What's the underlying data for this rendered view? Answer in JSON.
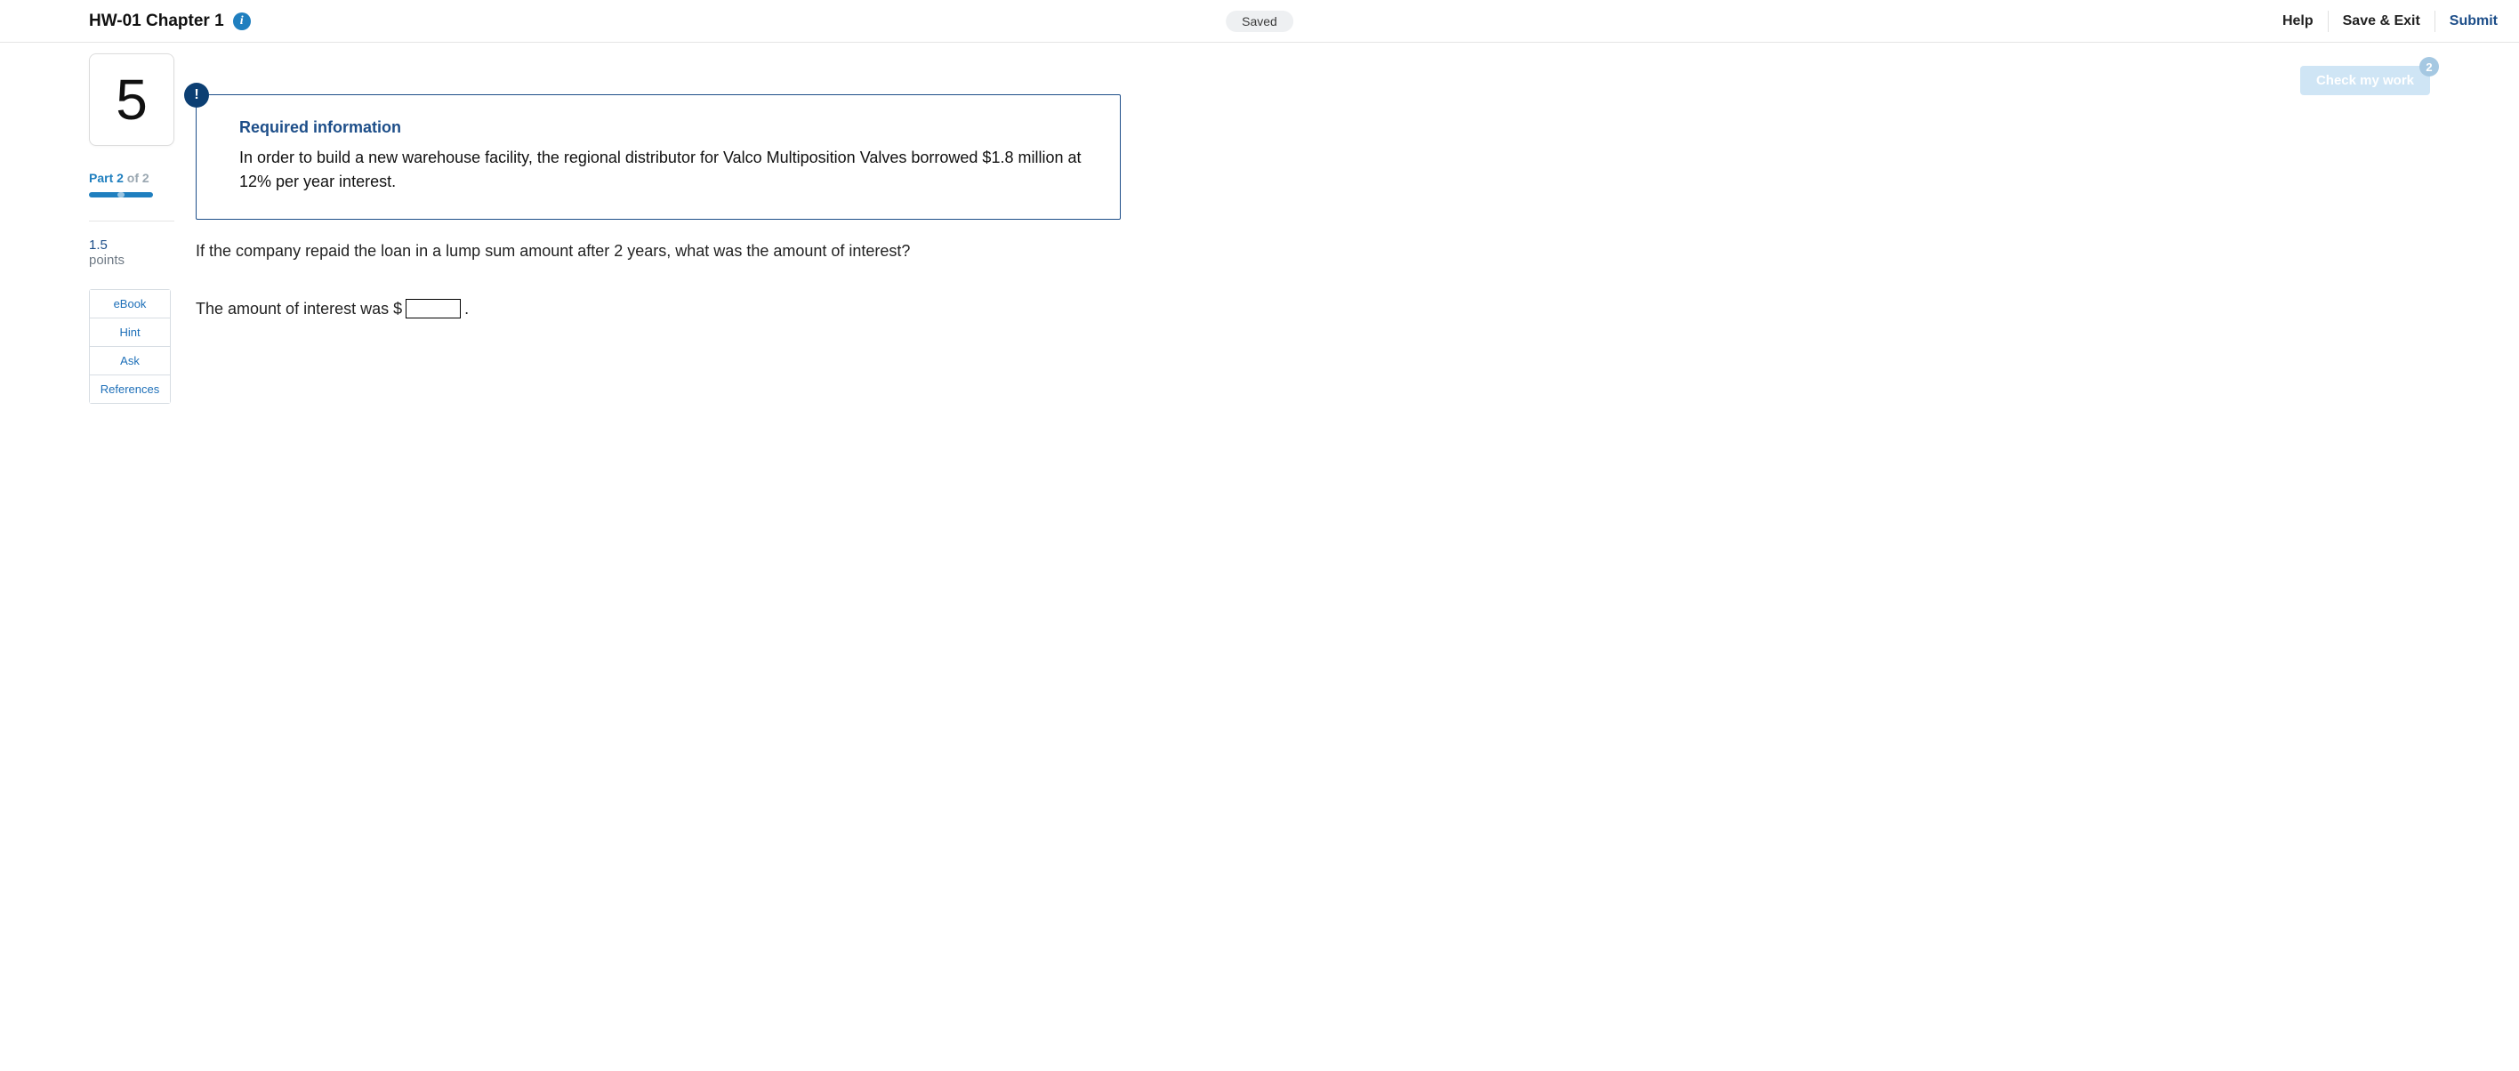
{
  "header": {
    "title": "HW-01 Chapter 1",
    "info_icon": "i",
    "saved_label": "Saved",
    "actions": {
      "help": "Help",
      "save_exit": "Save & Exit",
      "submit": "Submit"
    }
  },
  "check_work": {
    "label": "Check my work",
    "badge": "2"
  },
  "question": {
    "number": "5",
    "part_current": "Part 2",
    "part_of": " of 2",
    "points_value": "1.5",
    "points_label": "points"
  },
  "side_buttons": {
    "ebook": "eBook",
    "hint": "Hint",
    "ask": "Ask",
    "references": "References"
  },
  "required_info": {
    "badge": "!",
    "title": "Required information",
    "body": "In order to build a new warehouse facility, the regional distributor for Valco Multiposition Valves borrowed $1.8 million at 12% per year interest."
  },
  "prompt": "If the company repaid the loan in a lump sum amount after 2 years, what was the amount of interest?",
  "answer": {
    "prefix": "The amount of interest was $",
    "value": "",
    "suffix": "."
  }
}
